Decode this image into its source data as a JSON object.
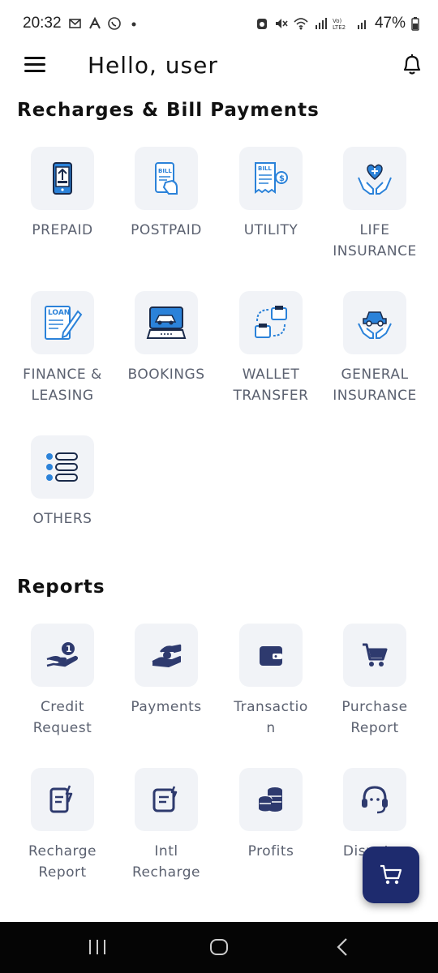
{
  "status_bar": {
    "time": "20:32",
    "battery": "47%",
    "left_icons": [
      "mail-icon",
      "a-icon",
      "whatsapp-icon",
      "dot-icon"
    ],
    "right_icons": [
      "alarm-icon",
      "mute-icon",
      "wifi-icon",
      "signal-icon",
      "volte-icon",
      "signal2-icon",
      "battery-icon"
    ]
  },
  "header": {
    "greeting": "Hello, user"
  },
  "recharges": {
    "title": "Recharges & Bill Payments",
    "items": [
      {
        "label": "PREPAID",
        "icon": "prepaid-icon"
      },
      {
        "label": "POSTPAID",
        "icon": "postpaid-bill-icon"
      },
      {
        "label": "UTILITY",
        "icon": "utility-bill-icon"
      },
      {
        "label": "LIFE\nINSURANCE",
        "icon": "life-insurance-icon"
      },
      {
        "label": "FINANCE &\nLEASING",
        "icon": "loan-icon"
      },
      {
        "label": "BOOKINGS",
        "icon": "bookings-icon"
      },
      {
        "label": "WALLET\nTRANSFER",
        "icon": "wallet-transfer-icon"
      },
      {
        "label": "GENERAL\nINSURANCE",
        "icon": "general-insurance-icon"
      },
      {
        "label": "OTHERS",
        "icon": "others-list-icon"
      }
    ]
  },
  "reports": {
    "title": "Reports",
    "items": [
      {
        "label": "Credit\nRequest",
        "icon": "credit-request-icon"
      },
      {
        "label": "Payments",
        "icon": "payments-icon"
      },
      {
        "label": "Transactio\nn",
        "icon": "wallet-icon"
      },
      {
        "label": "Purchase\nReport",
        "icon": "cart-icon"
      },
      {
        "label": "Recharge\nReport",
        "icon": "recharge-report-icon"
      },
      {
        "label": "Intl\nRecharge",
        "icon": "intl-recharge-icon"
      },
      {
        "label": "Profits",
        "icon": "coins-icon"
      },
      {
        "label": "Disputes",
        "icon": "headset-icon"
      }
    ]
  },
  "fab": {
    "icon": "cart-icon"
  },
  "colors": {
    "accent": "#1e2b6e",
    "icon_blue": "#2b82d9",
    "tile_bg": "#f1f3f7",
    "label": "#5b6170",
    "dark_icon": "#2e3a6e"
  }
}
